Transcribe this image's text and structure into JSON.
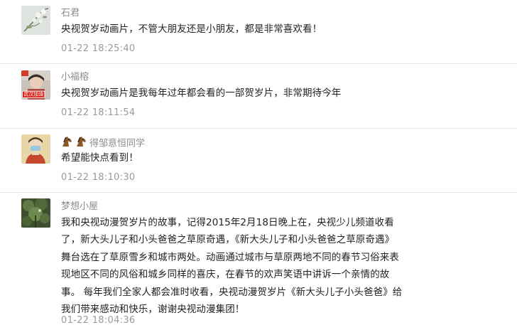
{
  "comments": [
    {
      "nickname": "石君",
      "text": "央视贺岁动画片，不管大朋友还是小朋友，都是非常喜欢看！",
      "time": "01-22 18:25:40",
      "avatar_icon": "flower-branch-avatar"
    },
    {
      "nickname": "小福榕",
      "text": "央视贺岁动画片是我每年过年都会看的一部贺岁片，非常期待今年",
      "time": "01-22 18:11:54",
      "avatar_icon": "child-photo-avatar",
      "avatar_badge": "武汉加油"
    },
    {
      "nickname_emojis": [
        "horse-emoji",
        "horse-emoji"
      ],
      "nickname": "得邹意恒同学",
      "text": "希望能快点看到！",
      "time": "01-22 18:10:30",
      "avatar_icon": "masked-person-avatar"
    },
    {
      "nickname": "梦想小屋",
      "text_lines": [
        "我和央视动漫贺岁片的故事，记得2015年2月18日晚上在，央视少儿频道收看",
        "了，新大头儿子和小头爸爸之草原奇遇，《新大头儿子和小头爸爸之草原奇遇》",
        "舞台选在了草原雪乡和城市两处。动画通过城市与草原两地不同的春节习俗来表",
        "现地区不同的风俗和城乡同样的喜庆，在春节的欢声笑语中讲诉一个亲情的故",
        "事。 每年我们全家人都会准时收看，央视动漫贺岁片《新大头儿子小头爸爸》给",
        "我们带来感动和快乐，谢谢央视动漫集团！"
      ],
      "time": "01-22 18:04:36",
      "avatar_icon": "plant-photo-avatar"
    }
  ]
}
